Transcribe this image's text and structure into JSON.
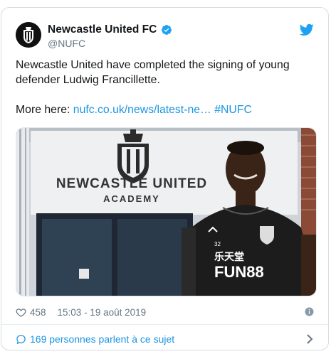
{
  "account": {
    "display_name": "Newcastle United FC",
    "handle": "@NUFC",
    "verified": true
  },
  "tweet": {
    "text_line1": "Newcastle United have completed the signing of young defender Ludwig Francillette.",
    "more_label": "More here: ",
    "link_text": "nufc.co.uk/news/latest-ne…",
    "hashtag": "#NUFC"
  },
  "photo": {
    "sign_line1": "NEWCASTLE UNITED",
    "sign_line2": "ACADEMY",
    "shirt_number": "32",
    "shirt_sponsor_cn": "乐天堂",
    "shirt_sponsor": "FUN88"
  },
  "meta": {
    "likes": "458",
    "timestamp": "15:03 - 19 août 2019"
  },
  "footer": {
    "conversation": "169 personnes parlent à ce sujet"
  },
  "colors": {
    "link": "#1b95e0",
    "verified": "#1da1f2",
    "muted": "#657786"
  },
  "icons": [
    "newcastle-crest-icon",
    "verified-badge-icon",
    "twitter-bird-icon",
    "heart-icon",
    "info-icon",
    "speech-bubble-icon",
    "chevron-right-icon"
  ]
}
